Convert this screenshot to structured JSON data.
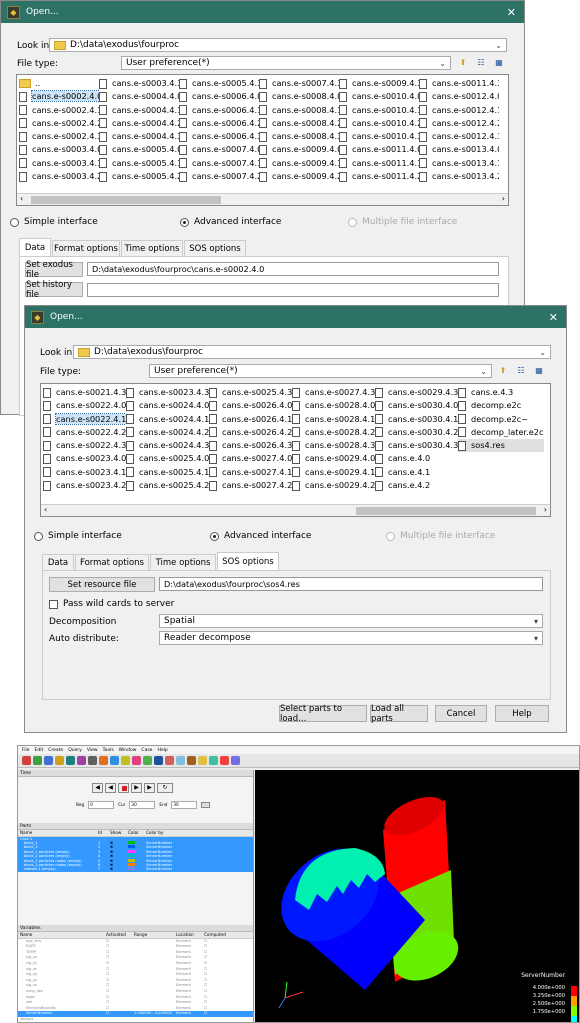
{
  "dialog1": {
    "title": "Open...",
    "close": "✕",
    "look_in_label": "Look in:",
    "look_in_value": "D:\\data\\exodus\\fourproc",
    "file_type_label": "File type:",
    "file_type_value": "User preference(*)",
    "columns": [
      [
        "..",
        "cans.e-s0002.4.0",
        "cans.e-s0002.4.1",
        "cans.e-s0002.4.2",
        "cans.e-s0002.4.3",
        "cans.e-s0003.4.0",
        "cans.e-s0003.4.1",
        "cans.e-s0003.4.2"
      ],
      [
        "cans.e-s0003.4.3",
        "cans.e-s0004.4.0",
        "cans.e-s0004.4.1",
        "cans.e-s0004.4.2",
        "cans.e-s0004.4.3",
        "cans.e-s0005.4.0",
        "cans.e-s0005.4.1",
        "cans.e-s0005.4.2"
      ],
      [
        "cans.e-s0005.4.3",
        "cans.e-s0006.4.0",
        "cans.e-s0006.4.1",
        "cans.e-s0006.4.2",
        "cans.e-s0006.4.3",
        "cans.e-s0007.4.0",
        "cans.e-s0007.4.1",
        "cans.e-s0007.4.2"
      ],
      [
        "cans.e-s0007.4.3",
        "cans.e-s0008.4.0",
        "cans.e-s0008.4.1",
        "cans.e-s0008.4.2",
        "cans.e-s0008.4.3",
        "cans.e-s0009.4.0",
        "cans.e-s0009.4.1",
        "cans.e-s0009.4.2"
      ],
      [
        "cans.e-s0009.4.3",
        "cans.e-s0010.4.0",
        "cans.e-s0010.4.1",
        "cans.e-s0010.4.2",
        "cans.e-s0010.4.3",
        "cans.e-s0011.4.0",
        "cans.e-s0011.4.1",
        "cans.e-s0011.4.2"
      ],
      [
        "cans.e-s0011.4.3",
        "cans.e-s0012.4.0",
        "cans.e-s0012.4.1",
        "cans.e-s0012.4.2",
        "cans.e-s0012.4.3",
        "cans.e-s0013.4.0",
        "cans.e-s0013.4.1",
        "cans.e-s0013.4.2"
      ]
    ],
    "selected": "cans.e-s0002.4.0",
    "interface_options": [
      "Simple interface",
      "Advanced interface",
      "Multiple file interface"
    ],
    "tabs": [
      "Data",
      "Format options",
      "Time options",
      "SOS options"
    ],
    "set_exodus_label": "Set exodus file",
    "exodus_value": "D:\\data\\exodus\\fourproc\\cans.e-s0002.4.0",
    "set_history_label": "Set history file",
    "history_value": ""
  },
  "dialog2": {
    "title": "Open...",
    "close": "✕",
    "look_in_label": "Look in:",
    "look_in_value": "D:\\data\\exodus\\fourproc",
    "file_type_label": "File type:",
    "file_type_value": "User preference(*)",
    "columns": [
      [
        "cans.e-s0021.4.3",
        "cans.e-s0022.4.0",
        "cans.e-s0022.4.1",
        "cans.e-s0022.4.2",
        "cans.e-s0022.4.3",
        "cans.e-s0023.4.0",
        "cans.e-s0023.4.1",
        "cans.e-s0023.4.2"
      ],
      [
        "cans.e-s0023.4.3",
        "cans.e-s0024.4.0",
        "cans.e-s0024.4.1",
        "cans.e-s0024.4.2",
        "cans.e-s0024.4.3",
        "cans.e-s0025.4.0",
        "cans.e-s0025.4.1",
        "cans.e-s0025.4.2"
      ],
      [
        "cans.e-s0025.4.3",
        "cans.e-s0026.4.0",
        "cans.e-s0026.4.1",
        "cans.e-s0026.4.2",
        "cans.e-s0026.4.3",
        "cans.e-s0027.4.0",
        "cans.e-s0027.4.1",
        "cans.e-s0027.4.2"
      ],
      [
        "cans.e-s0027.4.3",
        "cans.e-s0028.4.0",
        "cans.e-s0028.4.1",
        "cans.e-s0028.4.2",
        "cans.e-s0028.4.3",
        "cans.e-s0029.4.0",
        "cans.e-s0029.4.1",
        "cans.e-s0029.4.2"
      ],
      [
        "cans.e-s0029.4.3",
        "cans.e-s0030.4.0",
        "cans.e-s0030.4.1",
        "cans.e-s0030.4.2",
        "cans.e-s0030.4.3",
        "cans.e.4.0",
        "cans.e.4.1",
        "cans.e.4.2"
      ],
      [
        "cans.e.4.3",
        "decomp.e2c",
        "decomp.e2c~",
        "decomp_later.e2c",
        "sos4.res"
      ]
    ],
    "selected": "cans.e-s0022.4.1",
    "highlighted": "sos4.res",
    "interface_options": [
      "Simple interface",
      "Advanced interface",
      "Multiple file interface"
    ],
    "tabs": [
      "Data",
      "Format options",
      "Time options",
      "SOS options"
    ],
    "set_resource_label": "Set resource file",
    "resource_value": "D:\\data\\exodus\\fourproc\\sos4.res",
    "pass_wild_label": "Pass wild cards to server",
    "decomposition_label": "Decomposition",
    "decomposition_value": "Spatial",
    "auto_distribute_label": "Auto distribute:",
    "auto_distribute_value": "Reader decompose",
    "buttons": {
      "select_parts": "Select parts to load...",
      "load_all": "Load all parts",
      "cancel": "Cancel",
      "help": "Help"
    }
  },
  "ensight": {
    "menu": [
      "File",
      "Edit",
      "Create",
      "Query",
      "View",
      "Tools",
      "Window",
      "Case",
      "Help"
    ],
    "time_panel_title": "Time",
    "time_beg_label": "Beg",
    "time_beg": "0",
    "time_cur_label": "Cur",
    "time_cur": "30",
    "time_end_label": "End",
    "time_end": "30",
    "parts_title": "Parts",
    "parts_columns": [
      "Name",
      "Id",
      "Show",
      "Color",
      "Color by"
    ],
    "parts_rows": [
      {
        "name": "Case 1",
        "id": "",
        "color_by": ""
      },
      {
        "name": "block_1",
        "id": "1",
        "color_by": "ServerNumber"
      },
      {
        "name": "block_2",
        "id": "2",
        "color_by": "ServerNumber"
      },
      {
        "name": "block_1 particles (empty)",
        "id": "3",
        "color_by": "ServerNumber"
      },
      {
        "name": "block_2 particles (empty)",
        "id": "4",
        "color_by": "ServerNumber"
      },
      {
        "name": "block_1 particles nodes (empty)",
        "id": "5",
        "color_by": "ServerNumber"
      },
      {
        "name": "block_2 particles nodes (empty)",
        "id": "6",
        "color_by": "ServerNumber"
      },
      {
        "name": "sideset 1 (empty)",
        "id": "7",
        "color_by": "ServerNumber"
      }
    ],
    "variables_title": "Variables",
    "variables_columns": [
      "Name",
      "Activated",
      "Range",
      "Location",
      "Computed"
    ],
    "variables_rows": [
      {
        "name": "eqv_strs",
        "location": "Element"
      },
      {
        "name": "EQPS",
        "location": "Element"
      },
      {
        "name": "TEMP",
        "location": "Element"
      },
      {
        "name": "sig_xx",
        "location": "Element"
      },
      {
        "name": "sig_yy",
        "location": "Element"
      },
      {
        "name": "sig_zz",
        "location": "Element"
      },
      {
        "name": "sig_xy",
        "location": "Element"
      },
      {
        "name": "sig_yz",
        "location": "Element"
      },
      {
        "name": "sig_xz",
        "location": "Element"
      },
      {
        "name": "ushg_dev",
        "location": "Element"
      },
      {
        "name": "eqps",
        "location": "Element"
      },
      {
        "name": "sed",
        "location": "Element"
      },
      {
        "name": "ElementBlockIds",
        "location": "Element"
      },
      {
        "name": "ServerNumber",
        "range": "1.000000 - 4.000000",
        "location": "Element"
      },
      {
        "name": "Vectors",
        "location": ""
      }
    ],
    "legend_title": "ServerNumber",
    "legend_values": [
      "4.000e+000",
      "3.250e+000",
      "2.500e+000",
      "1.750e+000"
    ],
    "colors": {
      "red": "#ff0000",
      "green": "#80ff00",
      "blue": "#0000ff",
      "cyan": "#00ffb0"
    }
  }
}
